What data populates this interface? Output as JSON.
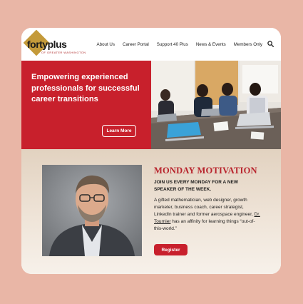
{
  "logo": {
    "name_part1": "forty",
    "name_part2": "plus",
    "subtitle": "OF GREATER WASHINGTON"
  },
  "nav": {
    "items": [
      {
        "label": "About Us"
      },
      {
        "label": "Career Portal"
      },
      {
        "label": "Support 40 Plus"
      },
      {
        "label": "News & Events"
      },
      {
        "label": "Members Only"
      }
    ],
    "search_icon": "search-icon"
  },
  "hero": {
    "headline": "Empowering experienced professionals for successful career transitions",
    "cta_label": "Learn More",
    "background_color": "#c8202c"
  },
  "motivation": {
    "title": "MONDAY MOTIVATION",
    "subtitle": "JOIN US EVERY MONDAY FOR A NEW SPEAKER OF THE WEEK.",
    "body_before_link": "A gifted mathematician, web designer, growth marketer, business coach, career strategist, LinkedIn trainer and former aerospace engineer, ",
    "body_link": "Dr. Tournier",
    "body_after_link": " has an affinity for learning things “out-of-this-world.”",
    "cta_label": "Register",
    "accent_color": "#b8232c"
  },
  "colors": {
    "page_background": "#e9b6a6",
    "brand_red": "#c8202c",
    "logo_gold": "#c49a3a"
  }
}
